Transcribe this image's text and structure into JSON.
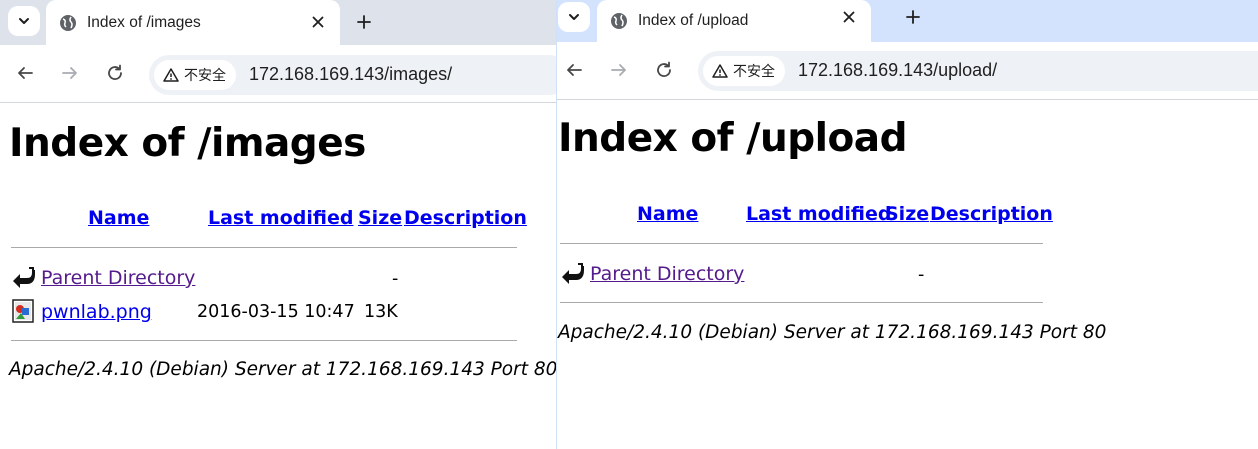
{
  "left": {
    "tab_title": "Index of /images",
    "security_label": "不安全",
    "url": "172.168.169.143/images/",
    "page_title": "Index of /images",
    "columns": {
      "name": "Name",
      "last_modified": "Last modified",
      "size": "Size",
      "description": "Description"
    },
    "rows": [
      {
        "icon": "back-arrow-icon",
        "name": "Parent Directory",
        "last_modified": "",
        "size": "-",
        "visited": true
      },
      {
        "icon": "image-file-icon",
        "name": "pwnlab.png",
        "last_modified": "2016-03-15 10:47",
        "size": "13K",
        "visited": false
      }
    ],
    "footer": "Apache/2.4.10 (Debian) Server at 172.168.169.143 Port 80"
  },
  "right": {
    "tab_title": "Index of /upload",
    "security_label": "不安全",
    "url": "172.168.169.143/upload/",
    "page_title": "Index of /upload",
    "columns": {
      "name": "Name",
      "last_modified": "Last modified",
      "size": "Size",
      "description": "Description"
    },
    "rows": [
      {
        "icon": "back-arrow-icon",
        "name": "Parent Directory",
        "last_modified": "",
        "size": "-",
        "visited": true
      }
    ],
    "footer": "Apache/2.4.10 (Debian) Server at 172.168.169.143 Port 80"
  },
  "colors": {
    "link": "#0000ee",
    "visited_link": "#551a8b",
    "tabstrip_left": "#dee3eb",
    "tabstrip_right": "#d3e3fd"
  }
}
